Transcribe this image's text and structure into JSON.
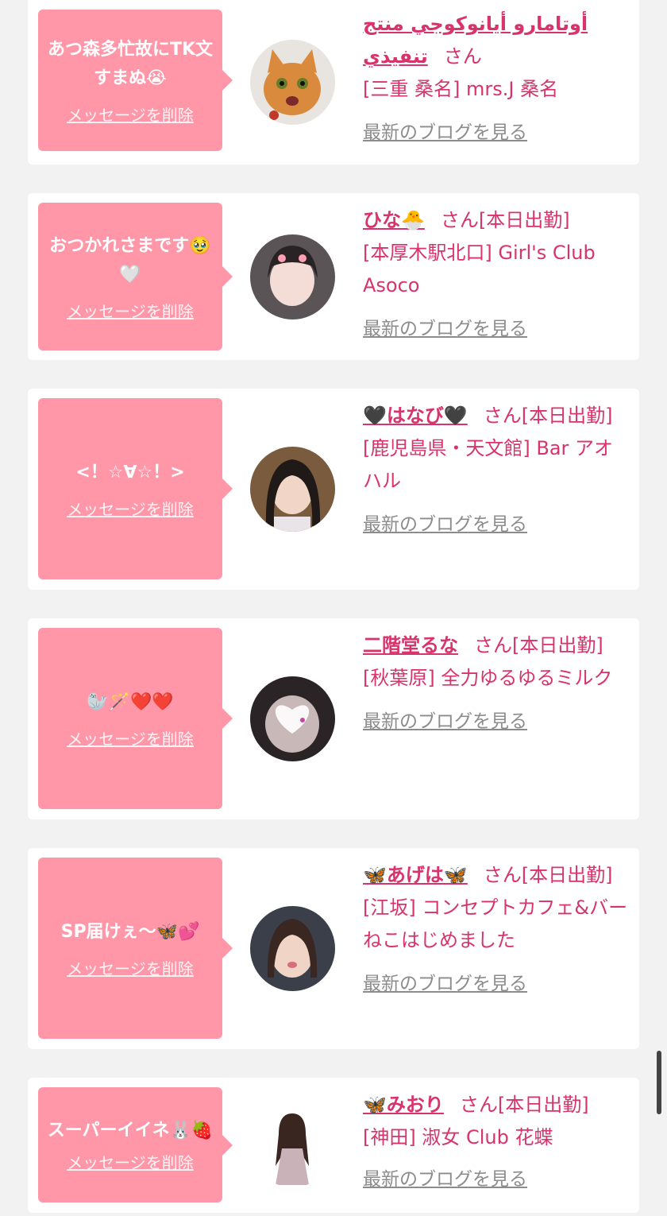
{
  "delete_label": "メッセージを削除",
  "blog_label": "最新のブログを見る",
  "colors": {
    "bubble": "#ff97a9",
    "accent": "#d8336a",
    "link_gray": "#8c8c8c"
  },
  "cards": [
    {
      "message": "あつ森多忙故にTK文すまぬ😭",
      "name": "أوتامارو أيانوكوجي منتج تنفيذي",
      "san": "さん",
      "status": "",
      "shop": "[三重 桑名] mrs.J 桑名",
      "avatar_icon": "cat-photo"
    },
    {
      "message": "おつかれさまです🥹🤍",
      "name": "ひな🐣",
      "san": "さん",
      "status": "[本日出勤]",
      "shop": "[本厚木駅北口] Girl's Club Asoco",
      "avatar_icon": "person-photo"
    },
    {
      "message": "<！☆∀☆！>",
      "name": "🖤はなび🖤",
      "san": "さん",
      "status": "[本日出勤]",
      "shop": "[鹿児島県・天文館] Bar アオハル",
      "avatar_icon": "person-photo"
    },
    {
      "message": "🦭🪄❤️❤️",
      "name": "二階堂るな",
      "san": "さん",
      "status": "[本日出勤]",
      "shop": "[秋葉原] 全力ゆるゆるミルク",
      "avatar_icon": "person-photo"
    },
    {
      "message": "SP届けぇ〜🦋💕",
      "name": "🦋あげは🦋",
      "san": "さん",
      "status": "[本日出勤]",
      "shop": "[江坂] コンセプトカフェ&バー　ねこはじめました",
      "avatar_icon": "person-photo"
    },
    {
      "message": "スーパーイイネ🐰🍓",
      "name": "🦋みおり",
      "san": "さん",
      "status": "[本日出勤]",
      "shop": "[神田] 淑女 Club 花蝶",
      "avatar_icon": "person-photo"
    }
  ]
}
